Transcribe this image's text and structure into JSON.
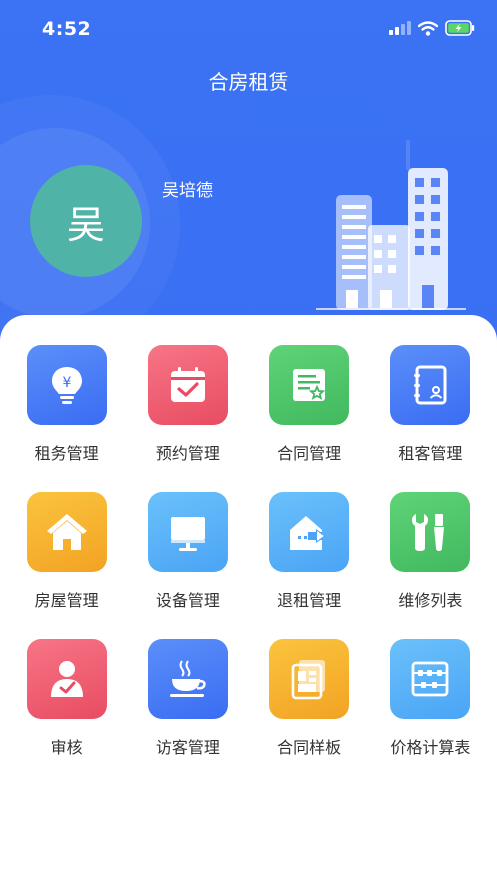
{
  "status_bar": {
    "time": "4:52"
  },
  "header": {
    "title": "合房租赁"
  },
  "user": {
    "avatar_char": "吴",
    "name": "吴培德"
  },
  "menu": [
    {
      "label": "租务管理",
      "icon": "money-bulb-icon",
      "color": "#4a7ef6"
    },
    {
      "label": "预约管理",
      "icon": "calendar-check-icon",
      "color": "#ef5d72"
    },
    {
      "label": "合同管理",
      "icon": "contract-icon",
      "color": "#4fc66b"
    },
    {
      "label": "租客管理",
      "icon": "tenant-book-icon",
      "color": "#4a7ef6"
    },
    {
      "label": "房屋管理",
      "icon": "house-icon",
      "color": "#f6b430"
    },
    {
      "label": "设备管理",
      "icon": "monitor-icon",
      "color": "#5ab3f8"
    },
    {
      "label": "退租管理",
      "icon": "move-out-icon",
      "color": "#5ab3f8"
    },
    {
      "label": "维修列表",
      "icon": "wrench-icon",
      "color": "#4fc66b"
    },
    {
      "label": "审核",
      "icon": "review-person-icon",
      "color": "#ef5d72"
    },
    {
      "label": "访客管理",
      "icon": "coffee-cup-icon",
      "color": "#4a7ef6"
    },
    {
      "label": "合同样板",
      "icon": "template-icon",
      "color": "#f6b430"
    },
    {
      "label": "价格计算表",
      "icon": "abacus-icon",
      "color": "#5ab3f8"
    }
  ]
}
